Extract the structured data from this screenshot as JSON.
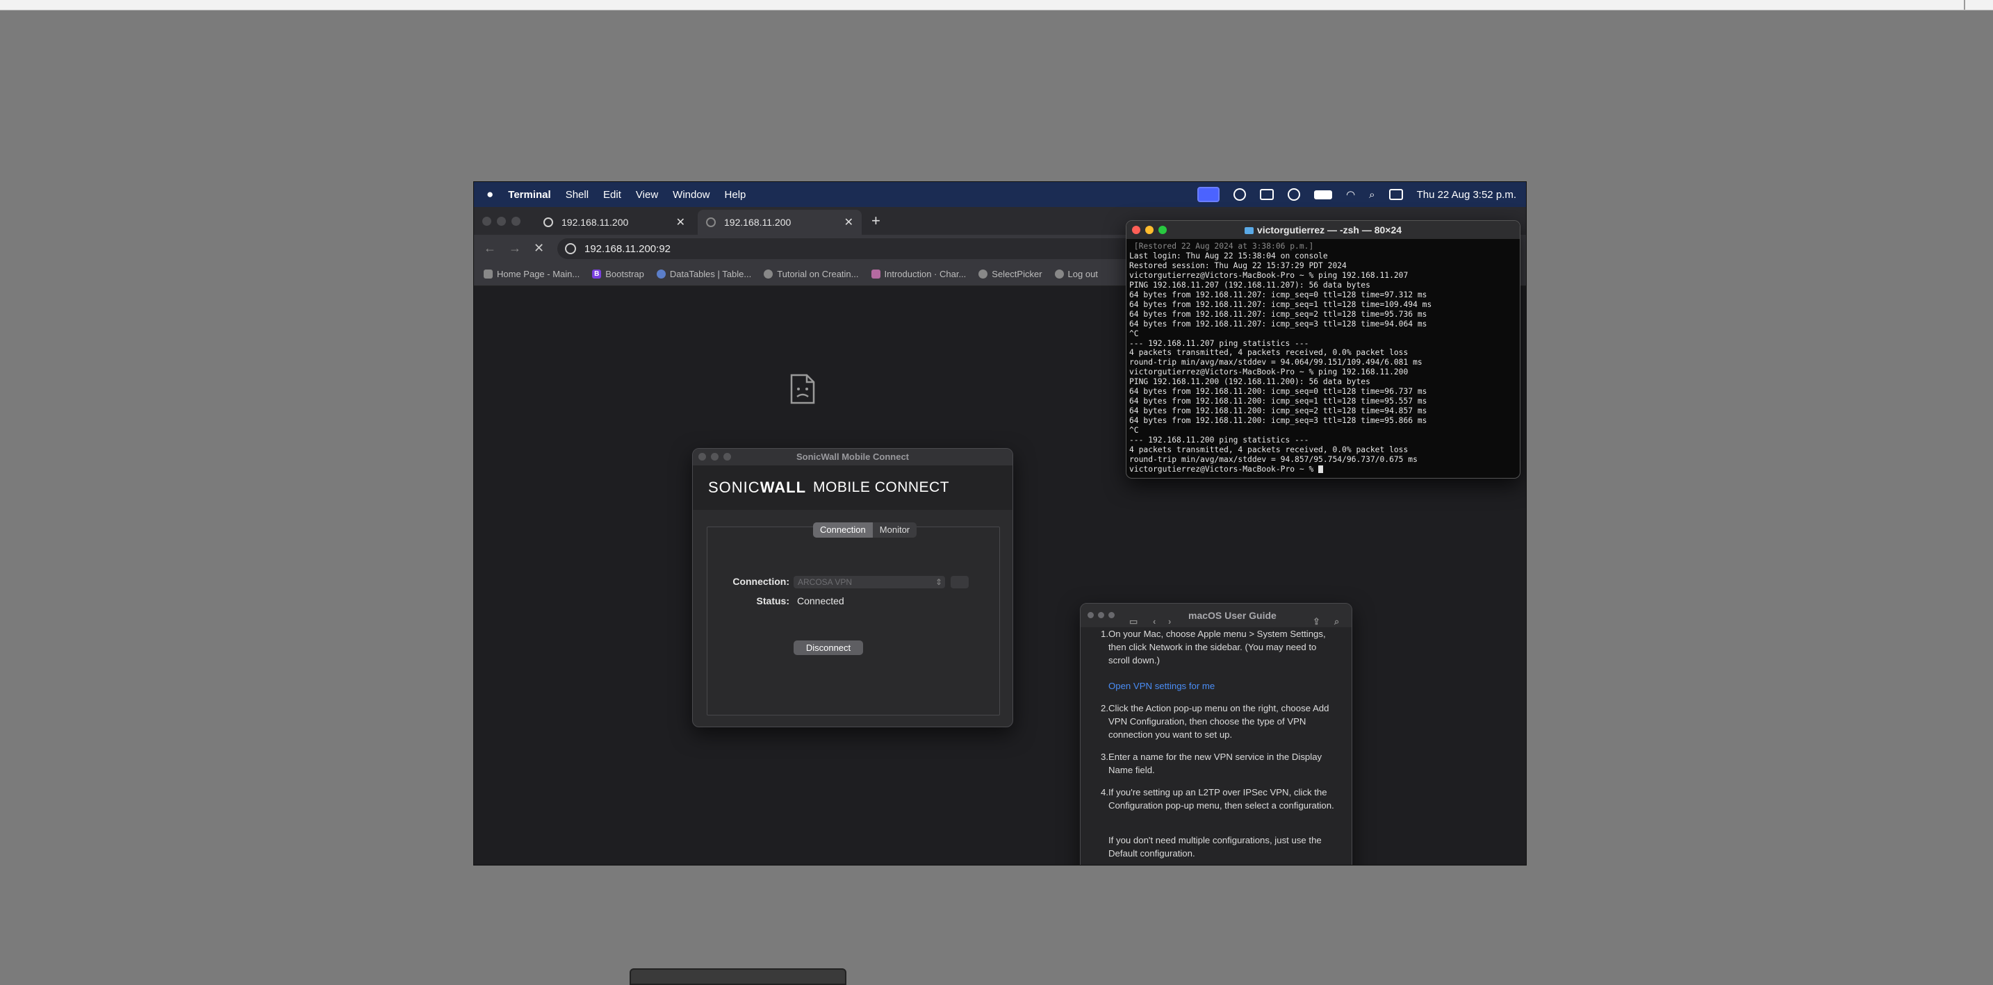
{
  "menubar": {
    "app": "Terminal",
    "items": [
      "Shell",
      "Edit",
      "View",
      "Window",
      "Help"
    ],
    "clock": "Thu 22 Aug  3:52 p.m.",
    "icons": [
      "screen-mirroring-icon",
      "cloud-icon",
      "card-icon",
      "shield-icon",
      "battery-icon",
      "wifi-icon",
      "search-icon",
      "control-center-icon"
    ]
  },
  "browser": {
    "tabs": [
      {
        "title": "192.168.11.200"
      },
      {
        "title": "192.168.11.200"
      }
    ],
    "url": "192.168.11.200:92",
    "bookmarks": [
      "Home Page - Main...",
      "Bootstrap",
      "DataTables | Table...",
      "Tutorial on Creatin...",
      "Introduction · Char...",
      "SelectPicker",
      "Log out"
    ]
  },
  "sonicwall": {
    "window_title": "SonicWall Mobile Connect",
    "brand_sonic": "SONIC",
    "brand_wall": "WALL",
    "brand_product": "MOBILE CONNECT",
    "tabs": [
      "Connection",
      "Monitor"
    ],
    "connection_label": "Connection:",
    "connection_value": "ARCOSA VPN",
    "status_label": "Status:",
    "status_value": "Connected",
    "disconnect_label": "Disconnect"
  },
  "terminal": {
    "title": "victorgutierrez — -zsh — 80×24",
    "lines": [
      " [Restored 22 Aug 2024 at 3:38:06 p.m.]",
      "Last login: Thu Aug 22 15:38:04 on console",
      "Restored session: Thu Aug 22 15:37:29 PDT 2024",
      "victorgutierrez@Victors-MacBook-Pro ~ % ping 192.168.11.207",
      "PING 192.168.11.207 (192.168.11.207): 56 data bytes",
      "64 bytes from 192.168.11.207: icmp_seq=0 ttl=128 time=97.312 ms",
      "64 bytes from 192.168.11.207: icmp_seq=1 ttl=128 time=109.494 ms",
      "64 bytes from 192.168.11.207: icmp_seq=2 ttl=128 time=95.736 ms",
      "64 bytes from 192.168.11.207: icmp_seq=3 ttl=128 time=94.064 ms",
      "^C",
      "--- 192.168.11.207 ping statistics ---",
      "4 packets transmitted, 4 packets received, 0.0% packet loss",
      "round-trip min/avg/max/stddev = 94.064/99.151/109.494/6.081 ms",
      "victorgutierrez@Victors-MacBook-Pro ~ % ping 192.168.11.200",
      "PING 192.168.11.200 (192.168.11.200): 56 data bytes",
      "64 bytes from 192.168.11.200: icmp_seq=0 ttl=128 time=96.737 ms",
      "64 bytes from 192.168.11.200: icmp_seq=1 ttl=128 time=95.557 ms",
      "64 bytes from 192.168.11.200: icmp_seq=2 ttl=128 time=94.857 ms",
      "64 bytes from 192.168.11.200: icmp_seq=3 ttl=128 time=95.866 ms",
      "^C",
      "--- 192.168.11.200 ping statistics ---",
      "4 packets transmitted, 4 packets received, 0.0% packet loss",
      "round-trip min/avg/max/stddev = 94.857/95.754/96.737/0.675 ms"
    ],
    "prompt": "victorgutierrez@Victors-MacBook-Pro ~ % "
  },
  "guide": {
    "title": "macOS User Guide",
    "steps": [
      {
        "num": "1.",
        "text": "On your Mac, choose Apple menu  > System Settings, then click Network  in the sidebar. (You may need to scroll down.)"
      },
      {
        "num": "2.",
        "text": "Click the Action pop-up menu  on the right, choose Add VPN Configuration, then choose the type of VPN connection you want to set up."
      },
      {
        "num": "3.",
        "text": "Enter a name for the new VPN service in the Display Name field."
      },
      {
        "num": "4.",
        "text": "If you're setting up an L2TP over IPSec VPN, click the Configuration pop-up menu, then select a configuration."
      }
    ],
    "link": "Open VPN settings for me",
    "note": "If you don't need multiple configurations, just use the Default configuration."
  }
}
